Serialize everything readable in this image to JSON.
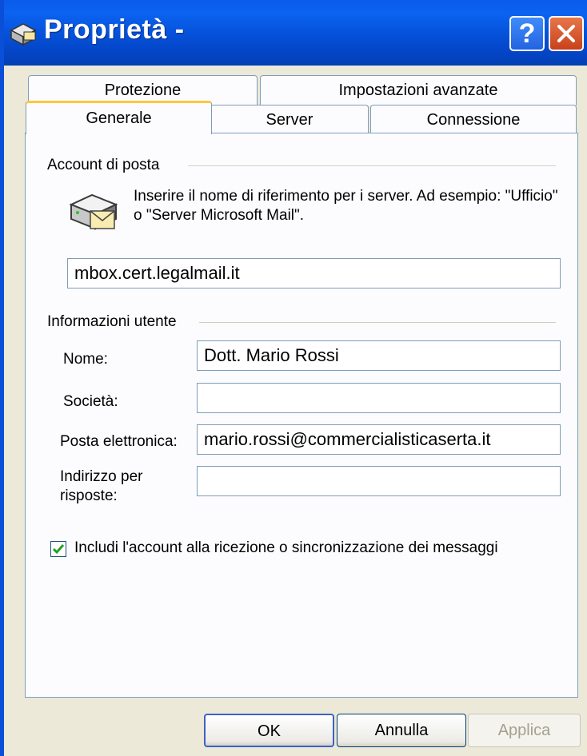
{
  "window": {
    "title": "Proprietà -"
  },
  "tabs": [
    {
      "label": "Protezione"
    },
    {
      "label": "Impostazioni avanzate"
    },
    {
      "label": "Generale",
      "active": true
    },
    {
      "label": "Server"
    },
    {
      "label": "Connessione"
    }
  ],
  "account": {
    "group_label": "Account di posta",
    "description": "Inserire il nome di riferimento per i server. Ad esempio: \"Ufficio\" o \"Server Microsoft Mail\".",
    "name_value": "mbox.cert.legalmail.it",
    "icon": "mail-server-icon"
  },
  "user": {
    "group_label": "Informazioni utente",
    "fields": [
      {
        "label": "Nome:",
        "value": "Dott. Mario Rossi"
      },
      {
        "label": "Società:",
        "value": ""
      },
      {
        "label": "Posta elettronica:",
        "value": "mario.rossi@commercialisticaserta.it"
      },
      {
        "label": "Indirizzo per risposte:",
        "value": ""
      }
    ]
  },
  "include_checkbox": {
    "label": "Includi l'account alla ricezione o sincronizzazione dei messaggi",
    "checked": true
  },
  "buttons": {
    "ok": "OK",
    "cancel": "Annulla",
    "apply": "Applica"
  },
  "titlebar_buttons": {
    "help": "?"
  },
  "colors": {
    "titlebar": "#0550d8",
    "panel_border": "#7f9db9",
    "active_tab_accent": "#ffc83c",
    "checkmark": "#21a121"
  }
}
